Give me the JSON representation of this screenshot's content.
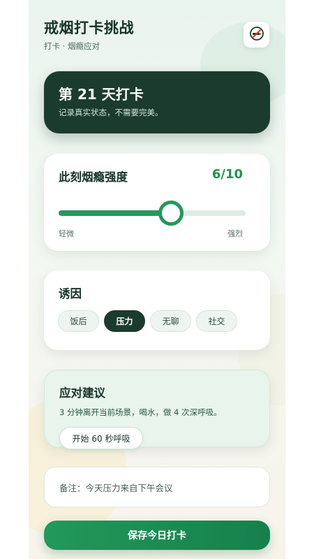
{
  "app": {
    "title": "戒烟打卡挑战",
    "subtitle": "打卡 · 烟瘾应对",
    "header_icon": "no-smoking-icon"
  },
  "day_card": {
    "title": "第 21 天打卡",
    "subtitle": "记录真实状态，不需要完美。"
  },
  "intensity": {
    "heading": "此刻烟瘾强度",
    "value_label": "6/10",
    "value": 6,
    "max": 10,
    "slider_fraction": 0.6,
    "min_label": "轻微",
    "max_label": "强烈"
  },
  "triggers": {
    "heading": "诱因",
    "options": [
      {
        "label": "饭后",
        "selected": false
      },
      {
        "label": "压力",
        "selected": true
      },
      {
        "label": "无聊",
        "selected": false
      },
      {
        "label": "社交",
        "selected": false
      }
    ]
  },
  "advice": {
    "heading": "应对建议",
    "text": "3 分钟离开当前场景，喝水，做 4 次深呼吸。",
    "button_label": "开始 60 秒呼吸"
  },
  "note": {
    "value": "备注：今天压力来自下午会议"
  },
  "save_button_label": "保存今日打卡",
  "colors": {
    "accent": "#22995a",
    "dark": "#1b3b2f",
    "background": "#eef5ef"
  }
}
